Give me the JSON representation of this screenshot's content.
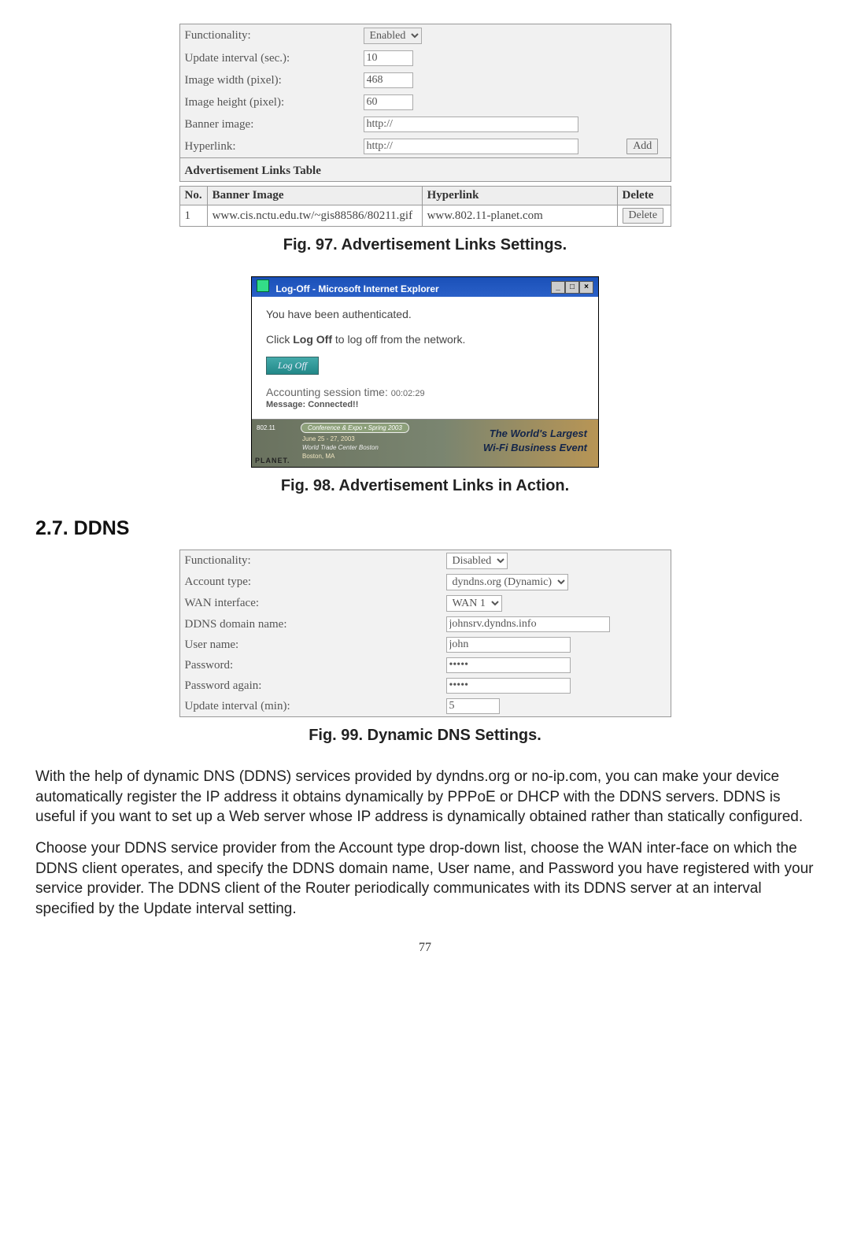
{
  "fig97": {
    "functionality_label": "Functionality:",
    "functionality_value": "Enabled",
    "update_interval_label": "Update interval (sec.):",
    "update_interval_value": "10",
    "image_width_label": "Image width (pixel):",
    "image_width_value": "468",
    "image_height_label": "Image height (pixel):",
    "image_height_value": "60",
    "banner_image_label": "Banner image:",
    "banner_image_value": "http://",
    "hyperlink_label": "Hyperlink:",
    "hyperlink_value": "http://",
    "add_btn": "Add",
    "table_heading": "Advertisement Links Table",
    "columns": {
      "no": "No.",
      "img": "Banner Image",
      "link": "Hyperlink",
      "del": "Delete"
    },
    "rows": [
      {
        "no": "1",
        "img": "www.cis.nctu.edu.tw/~gis88586/80211.gif",
        "link": "www.802.11-planet.com",
        "del": "Delete"
      }
    ],
    "caption": "Fig. 97. Advertisement Links Settings."
  },
  "fig98": {
    "window_title": "Log-Off - Microsoft Internet Explorer",
    "auth_line": "You have been authenticated.",
    "logoff_prefix": "Click ",
    "logoff_bold": "Log Off",
    "logoff_suffix": " to log off from the network.",
    "logoff_btn": "Log Off",
    "session_label": "Accounting session time:",
    "session_time": "00:02:29",
    "message_label": "Message:",
    "message_value": "Connected!!",
    "banner": {
      "pill": "Conference & Expo • Spring 2003",
      "dates": "June 25 - 27, 2003",
      "venue": "World Trade Center Boston",
      "city": "Boston, MA",
      "planet": "PLANET.",
      "tagline1": "The World's Largest",
      "tagline2": "Wi-Fi Business Event"
    },
    "caption": "Fig. 98. Advertisement Links in Action."
  },
  "section_heading": "2.7. DDNS",
  "fig99": {
    "functionality_label": "Functionality:",
    "functionality_value": "Disabled",
    "account_type_label": "Account type:",
    "account_type_value": "dyndns.org (Dynamic)",
    "wan_interface_label": "WAN interface:",
    "wan_interface_value": "WAN 1",
    "domain_label": "DDNS domain name:",
    "domain_value": "johnsrv.dyndns.info",
    "user_label": "User name:",
    "user_value": "john",
    "password_label": "Password:",
    "password_value": "•••••",
    "password_again_label": "Password again:",
    "password_again_value": "•••••",
    "update_interval_label": "Update interval (min):",
    "update_interval_value": "5",
    "caption": "Fig. 99. Dynamic DNS Settings."
  },
  "paragraph1": "With the help of dynamic DNS (DDNS) services provided by dyndns.org or no-ip.com, you can make your device automatically register the IP address it obtains dynamically by PPPoE or DHCP with the DDNS servers. DDNS is useful if you want to set up a Web server whose IP address is dynamically obtained rather than statically configured.",
  "paragraph2": "Choose your DDNS service provider from the Account type drop-down list, choose the WAN inter-face on which the DDNS client operates, and specify the DDNS domain name, User name, and Password you have registered with your service provider. The DDNS client of the Router periodically communicates with its DDNS server at an interval specified by the Update interval setting.",
  "page_number": "77"
}
